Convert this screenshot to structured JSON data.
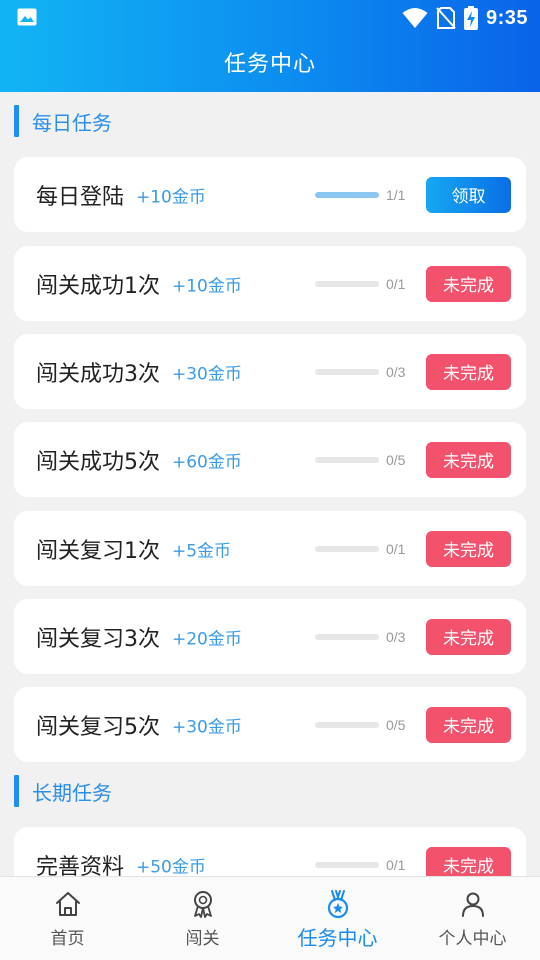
{
  "status_bar": {
    "time": "9:35",
    "icons": [
      "image-icon",
      "wifi-icon",
      "no-sim-icon",
      "battery-charging-icon"
    ]
  },
  "header": {
    "title": "任务中心"
  },
  "sections": {
    "daily": "每日任务",
    "long_term": "长期任务"
  },
  "tasks": [
    {
      "name": "每日登陆",
      "reward": "+10金币",
      "count": "1/1",
      "progress": 1.0,
      "button": "领取",
      "state": "claim"
    },
    {
      "name": "闯关成功1次",
      "reward": "+10金币",
      "count": "0/1",
      "progress": 0,
      "button": "未完成",
      "state": "pending"
    },
    {
      "name": "闯关成功3次",
      "reward": "+30金币",
      "count": "0/3",
      "progress": 0,
      "button": "未完成",
      "state": "pending"
    },
    {
      "name": "闯关成功5次",
      "reward": "+60金币",
      "count": "0/5",
      "progress": 0,
      "button": "未完成",
      "state": "pending"
    },
    {
      "name": "闯关复习1次",
      "reward": "+5金币",
      "count": "0/1",
      "progress": 0,
      "button": "未完成",
      "state": "pending"
    },
    {
      "name": "闯关复习3次",
      "reward": "+20金币",
      "count": "0/3",
      "progress": 0,
      "button": "未完成",
      "state": "pending"
    },
    {
      "name": "闯关复习5次",
      "reward": "+30金币",
      "count": "0/5",
      "progress": 0,
      "button": "未完成",
      "state": "pending"
    },
    {
      "name": "完善资料",
      "reward": "+50金币",
      "count": "0/1",
      "progress": 0,
      "button": "未完成",
      "state": "pending"
    }
  ],
  "nav": [
    {
      "label": "首页",
      "icon": "home-icon"
    },
    {
      "label": "闯关",
      "icon": "medal-ribbon-icon"
    },
    {
      "label": "任务中心",
      "icon": "task-medal-icon",
      "active": true
    },
    {
      "label": "个人中心",
      "icon": "user-icon"
    }
  ],
  "colors": {
    "accent": "#1a8cf0",
    "pending": "#f2526c",
    "reward": "#3a9be6"
  }
}
